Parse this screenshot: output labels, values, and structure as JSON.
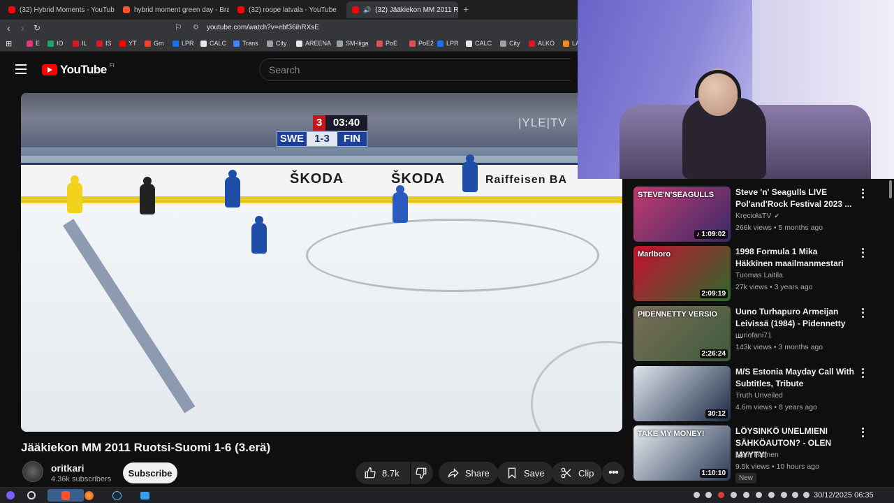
{
  "browser": {
    "tabs": [
      {
        "label": "(32) Hybrid Moments - YouTube"
      },
      {
        "label": "hybrid moment green day - Brav"
      },
      {
        "label": "(32) roope latvala - YouTube"
      },
      {
        "label": "(32) Jääkiekon MM 2011 R"
      }
    ],
    "new_tab": "+",
    "tab_close": "×",
    "url": "youtube.com/watch?v=ebf36ihRXsE",
    "bookmarks": [
      {
        "label": "E",
        "color": "#e0387a"
      },
      {
        "label": "IO",
        "color": "#1fa463"
      },
      {
        "label": "IL",
        "color": "#d11c24"
      },
      {
        "label": "IS",
        "color": "#d11c24"
      },
      {
        "label": "YT",
        "color": "#ff0000"
      },
      {
        "label": "Gm",
        "color": "#ea4335"
      },
      {
        "label": "LPR",
        "color": "#1a73e8"
      },
      {
        "label": "CALC",
        "color": "#e8e8e8"
      },
      {
        "label": "Trans",
        "color": "#4285f4"
      },
      {
        "label": "City",
        "color": "#9aa0a6"
      },
      {
        "label": "AREENA",
        "color": "#e8e8e8"
      },
      {
        "label": "SM-liiga",
        "color": "#9aa0a6"
      },
      {
        "label": "PoE",
        "color": "#d9534f"
      },
      {
        "label": "PoE2",
        "color": "#d9534f"
      },
      {
        "label": "LPR",
        "color": "#1a73e8"
      },
      {
        "label": "CALC",
        "color": "#e8e8e8"
      },
      {
        "label": "City",
        "color": "#9aa0a6"
      },
      {
        "label": "ALKO",
        "color": "#d11c24"
      },
      {
        "label": "LA",
        "color": "#f08a24"
      }
    ]
  },
  "youtube": {
    "logo_text": "YouTube",
    "region": "FI",
    "search_placeholder": "Search"
  },
  "video": {
    "scoreboard": {
      "period": "3",
      "clock": "03:40",
      "home": "SWE",
      "score": "1-3",
      "away": "FIN"
    },
    "broadcaster": "|YLE|TV",
    "board_ads": [
      "ŠKODA",
      "ŠKODA",
      "Raiffeisen BA"
    ],
    "title": "Jääkiekon MM 2011 Ruotsi-Suomi 1-6 (3.erä)",
    "channel": "oritkari",
    "subscribers": "4.36k subscribers",
    "subscribe_label": "Subscribe",
    "likes": "8.7k",
    "share_label": "Share",
    "save_label": "Save",
    "clip_label": "Clip"
  },
  "recommendations": [
    {
      "title": "Steve 'n' Seagulls LIVE Pol'and'Rock Festival 2023 ...",
      "channel": "KręciołaTV",
      "verified": "✔",
      "views": "266k views",
      "age": "5 months ago",
      "duration": "♪ 1:09:02",
      "thumb_text": "STEVE'N'SEAGULLS",
      "colors": [
        "#c23b6e",
        "#3a2a6a"
      ]
    },
    {
      "title": "1998 Formula 1 Mika Häkkinen maailmanmestari",
      "channel": "Tuomas Laitila",
      "views": "27k views",
      "age": "3 years ago",
      "duration": "2:09:19",
      "thumb_text": "Marlboro",
      "colors": [
        "#c8102e",
        "#2d6a2d"
      ]
    },
    {
      "title": "Uuno Turhapuro Armeijan Leivissä (1984) - Pidennetty ...",
      "channel": "uunofani71",
      "views": "143k views",
      "age": "3 months ago",
      "duration": "2:26:24",
      "thumb_text": "PIDENNETTY VERSIO",
      "colors": [
        "#7a6f5a",
        "#3e5a3a"
      ]
    },
    {
      "title": "M/S Estonia Mayday Call With Subtitles, Tribute",
      "channel": "Truth Unveiled",
      "views": "4.6m views",
      "age": "8 years ago",
      "duration": "30:12",
      "thumb_text": "",
      "colors": [
        "#dfe6ee",
        "#1b2a44"
      ]
    },
    {
      "title": "LÖYSINKÖ UNELMIENI SÄHKÖAUTON? - OLEN MYYTY!",
      "channel": "Lauri Halinen",
      "views": "9.5k views",
      "age": "10 hours ago",
      "duration": "1:10:10",
      "thumb_text": "TAKE MY MONEY!",
      "badge": "New",
      "colors": [
        "#e9eef3",
        "#2a3a55"
      ]
    }
  ],
  "taskbar": {
    "clock": "30/12/2025 06:35"
  }
}
